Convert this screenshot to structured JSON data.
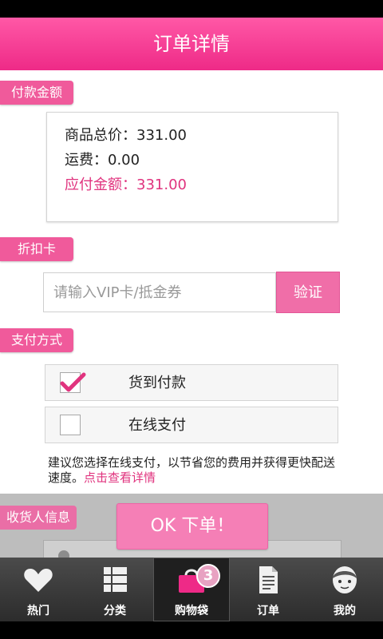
{
  "header": {
    "title": "订单详情"
  },
  "payment_amount": {
    "section_label": "付款金额",
    "goods_total": "商品总价：331.00",
    "shipping": "运费：0.00",
    "amount_due": "应付金额：331.00"
  },
  "discount": {
    "section_label": "折扣卡",
    "placeholder": "请输入VIP卡/抵金券",
    "verify_label": "验证"
  },
  "payment_method": {
    "section_label": "支付方式",
    "options": [
      {
        "label": "货到付款",
        "checked": true
      },
      {
        "label": "在线支付",
        "checked": false
      }
    ],
    "hint_text": "建议您选择在线支付，以节省您的费用并获得更快配送速度。",
    "hint_link": "点击查看详情"
  },
  "receiver": {
    "section_label": "收货人信息"
  },
  "ok_button": {
    "label": "OK 下单！"
  },
  "tabbar": {
    "tabs": [
      {
        "label": "热门",
        "icon": "heart-icon",
        "active": false
      },
      {
        "label": "分类",
        "icon": "grid-icon",
        "active": false
      },
      {
        "label": "购物袋",
        "icon": "shopping-bag-icon",
        "active": true
      },
      {
        "label": "订单",
        "icon": "document-icon",
        "active": false
      },
      {
        "label": "我的",
        "icon": "avatar-icon",
        "active": false
      }
    ],
    "cart_badge": "3"
  },
  "colors": {
    "accent": "#ee2a87",
    "tag": "#f05a9b",
    "due_text": "#e0337e",
    "tabbar": "#3a3a3a"
  }
}
